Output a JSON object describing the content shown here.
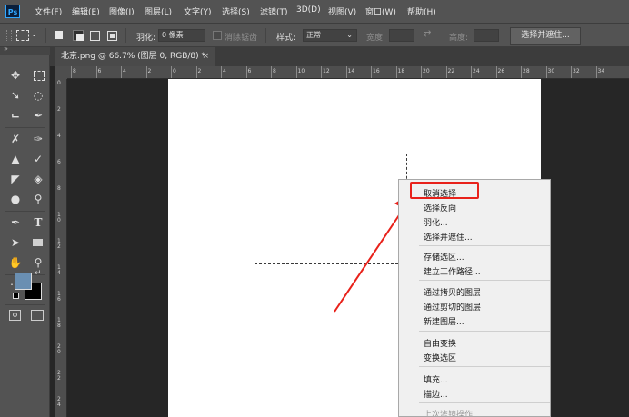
{
  "app": {
    "logo": "Ps"
  },
  "menu": [
    "文件(F)",
    "编辑(E)",
    "图像(I)",
    "图层(L)",
    "文字(Y)",
    "选择(S)",
    "滤镜(T)",
    "3D(D)",
    "视图(V)",
    "窗口(W)",
    "帮助(H)"
  ],
  "options": {
    "feather_label": "羽化:",
    "feather_value": "0 像素",
    "antialias_label": "消除锯齿",
    "style_label": "样式:",
    "style_value": "正常",
    "width_label": "宽度:",
    "height_label": "高度:",
    "select_mask_button": "选择并遮住..."
  },
  "document": {
    "tab_title": "北京.png @ 66.7% (图层 0, RGB/8) *",
    "close": "×"
  },
  "ruler": {
    "horizontal": [
      "8",
      "6",
      "4",
      "2",
      "0",
      "2",
      "4",
      "6",
      "8",
      "10",
      "12",
      "14",
      "16",
      "18",
      "20",
      "22",
      "24",
      "26",
      "28",
      "30",
      "32",
      "34"
    ],
    "vertical": [
      "0",
      "2",
      "4",
      "6",
      "8",
      "1\n0",
      "1\n2",
      "1\n4",
      "1\n6",
      "1\n8",
      "2\n0",
      "2\n2",
      "2\n4"
    ]
  },
  "colors": {
    "foreground": "#6a8fb2",
    "background": "#000000",
    "highlight": "#e8211a"
  },
  "context_menu": {
    "items": [
      {
        "label": "取消选择",
        "enabled": true
      },
      {
        "label": "选择反向",
        "enabled": true
      },
      {
        "label": "羽化...",
        "enabled": true
      },
      {
        "label": "选择并遮住...",
        "enabled": true
      },
      {
        "label": "存储选区...",
        "enabled": true
      },
      {
        "label": "建立工作路径...",
        "enabled": true
      },
      {
        "label": "通过拷贝的图层",
        "enabled": true
      },
      {
        "label": "通过剪切的图层",
        "enabled": true
      },
      {
        "label": "新建图层...",
        "enabled": true
      },
      {
        "label": "自由变换",
        "enabled": true
      },
      {
        "label": "变换选区",
        "enabled": true
      },
      {
        "label": "填充...",
        "enabled": true
      },
      {
        "label": "描边...",
        "enabled": true
      },
      {
        "label": "上次滤镜操作",
        "enabled": false
      }
    ],
    "highlighted": "取消选择"
  },
  "tools": [
    "move-tool",
    "marquee-tool",
    "lasso-tool",
    "quick-select-tool",
    "crop-tool",
    "eyedropper-tool",
    "healing-brush-tool",
    "brush-tool",
    "clone-stamp-tool",
    "history-brush-tool",
    "eraser-tool",
    "paint-bucket-tool",
    "blur-tool",
    "dodge-tool",
    "pen-tool",
    "type-tool",
    "path-select-tool",
    "rectangle-tool",
    "hand-tool",
    "zoom-tool",
    "more-tools"
  ]
}
